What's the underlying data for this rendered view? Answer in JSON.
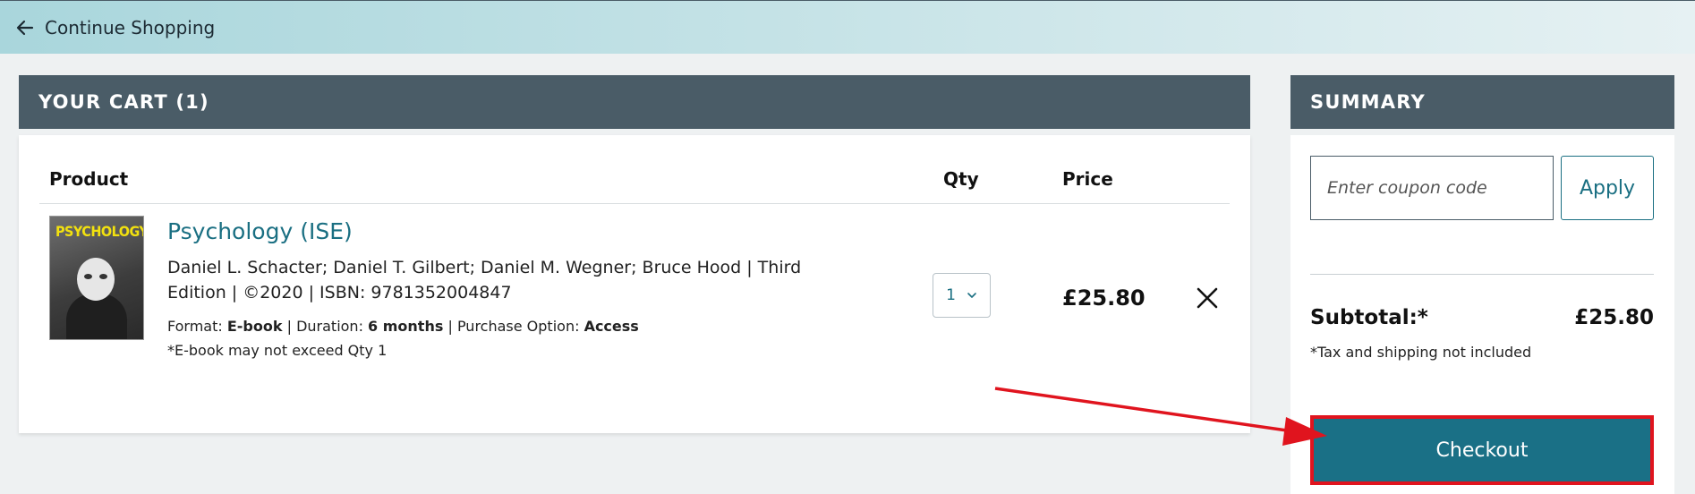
{
  "topbar": {
    "back_label": "Continue Shopping"
  },
  "cart": {
    "header": "YOUR CART (1)",
    "columns": {
      "product": "Product",
      "qty": "Qty",
      "price": "Price"
    },
    "item": {
      "name": "Psychology (ISE)",
      "cover_title": "PSYCHOLOGY",
      "meta": "Daniel L. Schacter; Daniel T. Gilbert; Daniel M. Wegner; Bruce Hood | Third Edition | ©2020 | ISBN: 9781352004847",
      "format_label": "Format: ",
      "format_value": "E-book",
      "duration_label": "Duration: ",
      "duration_value": "6 months",
      "option_label": "Purchase Option: ",
      "option_value": "Access",
      "separator": " | ",
      "note": "*E-book may not exceed Qty 1",
      "qty": "1",
      "price": "£25.80"
    }
  },
  "summary": {
    "header": "SUMMARY",
    "coupon_placeholder": "Enter coupon code",
    "apply_label": "Apply",
    "subtotal_label": "Subtotal:*",
    "subtotal_value": "£25.80",
    "tax_note": "*Tax and shipping not included",
    "checkout_label": "Checkout"
  },
  "colors": {
    "header_bg": "#4a5c67",
    "link": "#1a6f82",
    "checkout_bg": "#1a7086",
    "highlight": "#e0141e"
  },
  "icons": [
    "arrow-left-icon",
    "chevron-down-icon",
    "close-icon"
  ]
}
